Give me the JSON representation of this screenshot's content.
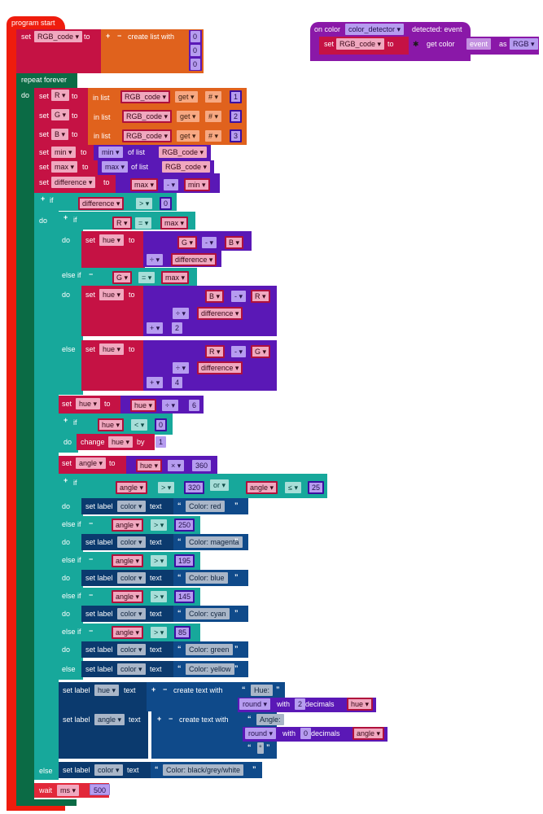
{
  "program_start": {
    "hat_label": "program start",
    "init": {
      "set": "set",
      "var": "RGB_code",
      "to": "to",
      "plus": "+",
      "minus": "−",
      "create": "create list with",
      "items": [
        "0",
        "0",
        "0"
      ]
    }
  },
  "event_block": {
    "on_color": "on color",
    "sensor": "color_detector",
    "detected": "detected: event",
    "set": "set",
    "var": "RGB_code",
    "to": "to",
    "get_color": "get color",
    "event": "event",
    "as": "as",
    "format": "RGB"
  },
  "loop": {
    "label": "repeat forever",
    "do": "do"
  },
  "assign_rgb": [
    {
      "var": "R",
      "index": "1"
    },
    {
      "var": "G",
      "index": "2"
    },
    {
      "var": "B",
      "index": "3"
    }
  ],
  "common": {
    "set": "set",
    "to": "to",
    "in_list": "in list",
    "list": "RGB_code",
    "get": "get",
    "hash": "#",
    "of_list": "of list",
    "do": "do",
    "if": "if",
    "else_if": "else if",
    "else": "else",
    "plus": "+",
    "minus": "−",
    "set_label": "set label",
    "text": "text",
    "change": "change",
    "by": "by",
    "or": "or",
    "create_text": "create text with",
    "round": "round",
    "with": "with",
    "decimals": "decimals",
    "open_quote": "“",
    "close_quote": "”",
    "wait": "wait"
  },
  "min_max": [
    {
      "var": "min",
      "fn": "min",
      "list": "RGB_code"
    },
    {
      "var": "max",
      "fn": "max",
      "list": "RGB_code"
    }
  ],
  "difference": {
    "var": "difference",
    "a": "max",
    "op": "-",
    "b": "min"
  },
  "outer_if": {
    "var": "difference",
    "op": ">",
    "val": "0"
  },
  "hue_if": {
    "c1": {
      "a": "R",
      "op": "=",
      "b": "max"
    },
    "d1": {
      "var": "hue",
      "a": "G",
      "op": "-",
      "b": "B",
      "div": "÷",
      "d": "difference"
    },
    "c2": {
      "a": "G",
      "op": "=",
      "b": "max"
    },
    "d2": {
      "var": "hue",
      "a": "B",
      "op": "-",
      "b": "R",
      "div": "÷",
      "d": "difference",
      "add": "+",
      "n": "2"
    },
    "d3": {
      "var": "hue",
      "a": "R",
      "op": "-",
      "b": "G",
      "div": "÷",
      "d": "difference",
      "add": "+",
      "n": "4"
    }
  },
  "hue_div": {
    "var": "hue",
    "a": "hue",
    "op": "÷",
    "n": "6"
  },
  "neg_if": {
    "a": "hue",
    "op": "<",
    "n": "0",
    "var": "hue",
    "by": "1"
  },
  "angle_set": {
    "var": "angle",
    "a": "hue",
    "op": "×",
    "n": "360"
  },
  "color_if": {
    "first": {
      "a": "angle",
      "op": ">",
      "n": "320",
      "b": "angle",
      "op2": "≤",
      "n2": "25"
    },
    "label_target": "color",
    "branches": [
      {
        "threshold": "",
        "text": "Color: red"
      },
      {
        "threshold": "250",
        "text": "Color: magenta"
      },
      {
        "threshold": "195",
        "text": "Color: blue"
      },
      {
        "threshold": "145",
        "text": "Color: cyan"
      },
      {
        "threshold": "85",
        "text": "Color: green"
      }
    ],
    "else_text": "Color: yellow",
    "cmp_var": "angle",
    "cmp_op": ">"
  },
  "labels": {
    "hue_label": "hue",
    "hue_prefix": "Hue:",
    "hue_decimals": "2",
    "hue_var": "hue",
    "angle_label": "angle",
    "angle_prefix": "Angle:",
    "angle_decimals": "0",
    "angle_var": "angle",
    "degree": "°"
  },
  "else_label": {
    "target": "color",
    "text": "Color: black/grey/white"
  },
  "wait": {
    "unit": "ms",
    "value": "500"
  }
}
